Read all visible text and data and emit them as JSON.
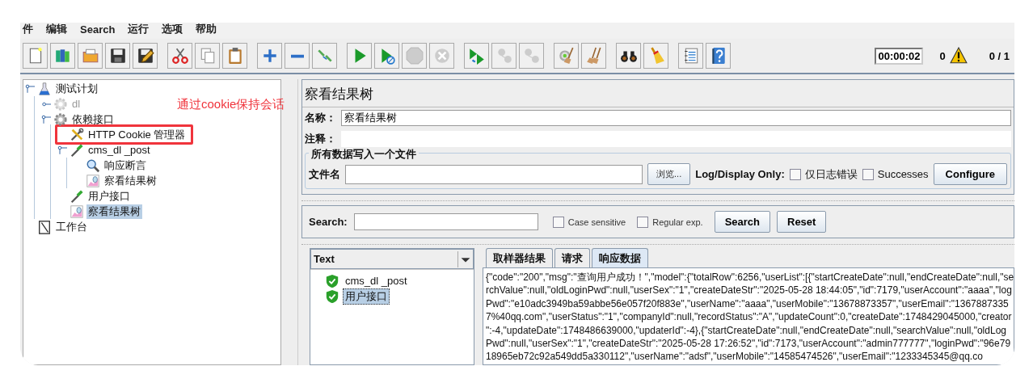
{
  "menu": [
    {
      "label": "件"
    },
    {
      "label": "编辑"
    },
    {
      "label": "Search"
    },
    {
      "label": "运行"
    },
    {
      "label": "选项"
    },
    {
      "label": "帮助"
    }
  ],
  "status": {
    "timer": "00:00:02",
    "warnings": "0",
    "threads": "0 / 1"
  },
  "tree": [
    {
      "label": "测试计划",
      "kind": "plan",
      "selected": false,
      "disabled": false,
      "annotated": false,
      "expanded": true,
      "children": [
        {
          "label": "dl",
          "kind": "group",
          "selected": false,
          "disabled": true,
          "annotated": false,
          "expanded": false
        },
        {
          "label": "依赖接口",
          "kind": "group",
          "selected": false,
          "disabled": false,
          "annotated": false,
          "expanded": true,
          "children": [
            {
              "label": "HTTP Cookie 管理器",
              "kind": "config",
              "selected": false,
              "disabled": false,
              "annotated": true
            },
            {
              "label": "cms_dl _post",
              "kind": "sampler",
              "selected": false,
              "disabled": false,
              "annotated": false,
              "expanded": true,
              "children": [
                {
                  "label": "响应断言",
                  "kind": "assertion",
                  "selected": false,
                  "disabled": false,
                  "annotated": false
                },
                {
                  "label": "察看结果树",
                  "kind": "listener",
                  "selected": false,
                  "disabled": false,
                  "annotated": false
                }
              ]
            },
            {
              "label": "用户接口",
              "kind": "sampler",
              "selected": false,
              "disabled": false,
              "annotated": false
            },
            {
              "label": "察看结果树",
              "kind": "listener",
              "selected": true,
              "disabled": false,
              "annotated": false
            }
          ]
        }
      ]
    },
    {
      "label": "工作台",
      "kind": "workbench",
      "selected": false,
      "disabled": false,
      "annotated": false
    }
  ],
  "annotation": "通过cookie保持会话",
  "viewer": {
    "title": "察看结果树",
    "name_label": "名称：",
    "name_value": "察看结果树",
    "comment_label": "注释：",
    "file_group": "所有数据写入一个文件",
    "file_label": "文件名",
    "browse": "浏览...",
    "log_label": "Log/Display Only:",
    "log_options": [
      {
        "label": "仅日志错误",
        "checked": false
      },
      {
        "label": "Successes",
        "checked": false
      }
    ],
    "configure": "Configure",
    "search_label": "Search:",
    "search_options": [
      {
        "label": "Case sensitive",
        "checked": false
      },
      {
        "label": "Regular exp.",
        "checked": false
      }
    ],
    "search_buttons": [
      "Search",
      "Reset"
    ],
    "renderer": "Text",
    "results": [
      {
        "label": "cms_dl _post",
        "success": true,
        "selected": false
      },
      {
        "label": "用户接口",
        "success": true,
        "selected": true
      }
    ],
    "tabs": [
      {
        "label": "取样器结果",
        "selected": false
      },
      {
        "label": "请求",
        "selected": false
      },
      {
        "label": "响应数据",
        "selected": true
      }
    ],
    "response_lines": [
      "{\"code\":\"200\",\"msg\":\"查询用户成功！\",\"model\":{\"totalRow\":6256,\"userList\":[{\"startCreateDate\":null,\"endCreateDate\":null,\"se",
      "rchValue\":null,\"oldLoginPwd\":null,\"userSex\":\"1\",\"createDateStr\":\"2025-05-28 18:44:05\",\"id\":7179,\"userAccount\":\"aaaa\",\"log",
      "Pwd\":\"e10adc3949ba59abbe56e057f20f883e\",\"userName\":\"aaaa\",\"userMobile\":\"13678873357\",\"userEmail\":\"1367887335",
      "7%40qq.com\",\"userStatus\":\"1\",\"companyId\":null,\"recordStatus\":\"A\",\"updateCount\":0,\"createDate\":1748429045000,\"creator",
      "\":-4,\"updateDate\":1748486639000,\"updaterId\":-4},{\"startCreateDate\":null,\"endCreateDate\":null,\"searchValue\":null,\"oldLog",
      "Pwd\":null,\"userSex\":\"1\",\"createDateStr\":\"2025-05-28 17:26:52\",\"id\":7173,\"userAccount\":\"admin777777\",\"loginPwd\":\"96e79",
      "18965eb72c92a549dd5a330112\",\"userName\":\"adsf\",\"userMobile\":\"14585474526\",\"userEmail\":\"1233345345@qq.co"
    ]
  }
}
